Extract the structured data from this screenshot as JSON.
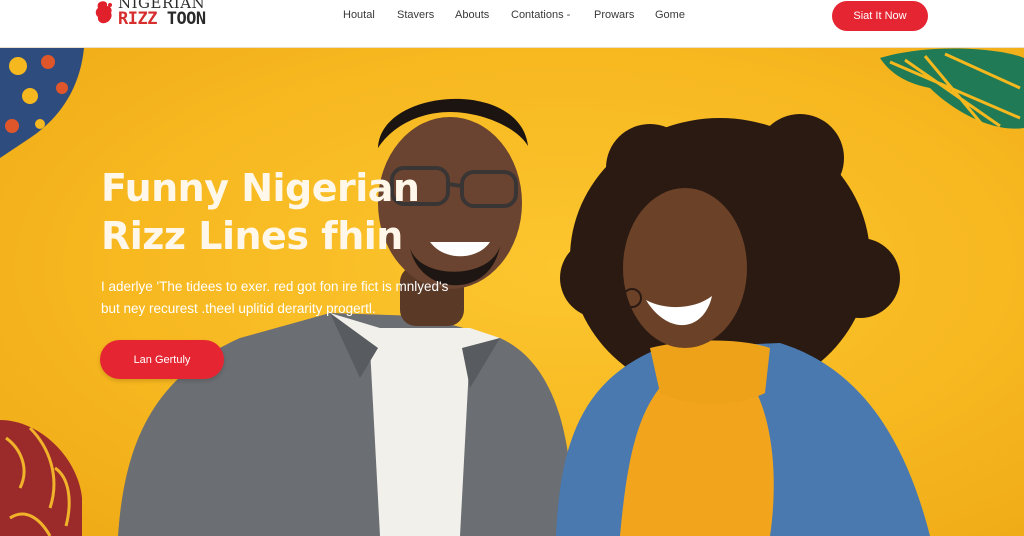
{
  "header": {
    "logo": {
      "line1": "NIGERIAN",
      "line2_a": "RIZZ",
      "line2_b": "TOON"
    },
    "nav": [
      "Houtal",
      "Stavers",
      "Abouts",
      "Contations -",
      "Prowars",
      "Gome"
    ],
    "cta_label": "Siat It Now"
  },
  "hero": {
    "title_lines": [
      "Funny Nigerian",
      "Rizz Lines fhin"
    ],
    "subtitle_lines": [
      "I aderlye 'The tidees to exer. red got fon ire fict is mnlyed's",
      "but ney recurest .theel uplitid derarity progertl."
    ],
    "cta_label": "Lan Gertuly"
  },
  "colors": {
    "background": "#f6b81f",
    "accent_red": "#e52532",
    "header_bg": "#ffffff",
    "title_text": "#fff8ea"
  }
}
